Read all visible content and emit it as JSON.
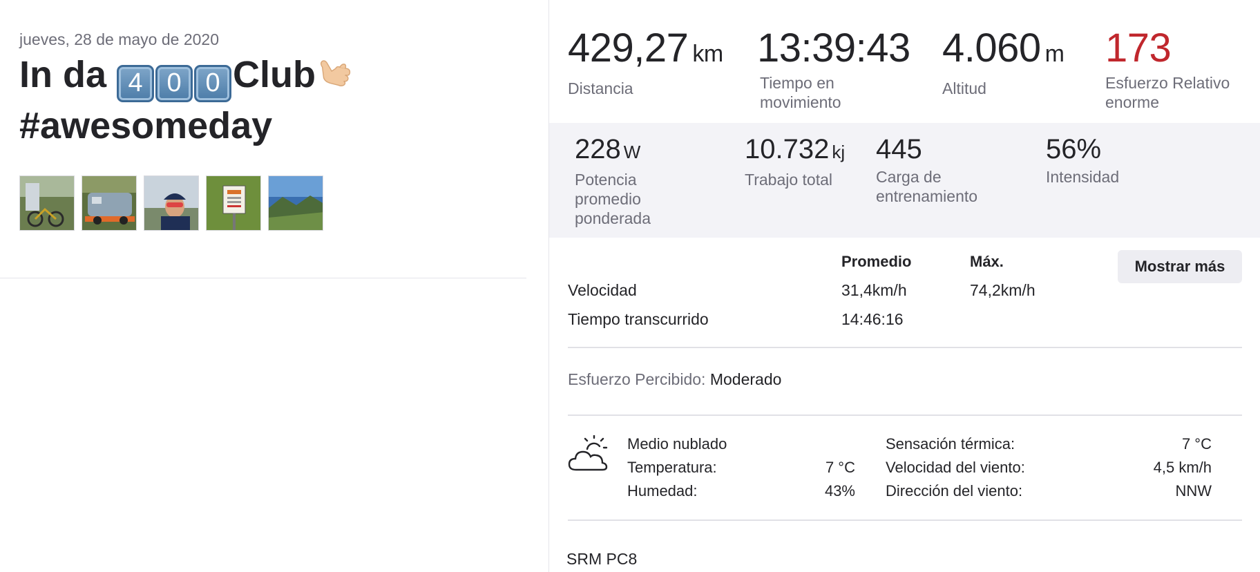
{
  "activity": {
    "date": "jueves, 28 de mayo de 2020",
    "title_prefix": "In da ",
    "title_keycaps": [
      "4",
      "0",
      "0"
    ],
    "title_suffix": "Club",
    "title_line2": "#awesomeday",
    "photos": [
      {
        "name": "photo-bike-shed"
      },
      {
        "name": "photo-blue-van"
      },
      {
        "name": "photo-selfie-cyclist"
      },
      {
        "name": "photo-road-sign"
      },
      {
        "name": "photo-mountain-valley"
      }
    ]
  },
  "summary": {
    "distance": {
      "value": "429,27",
      "unit": "km",
      "label": "Distancia"
    },
    "moving_time": {
      "value": "13:39:43",
      "label_line1": "Tiempo en",
      "label_line2": "movimiento"
    },
    "elevation": {
      "value": "4.060",
      "unit": "m",
      "label": "Altitud"
    },
    "relative_effort": {
      "value": "173",
      "label_line1": "Esfuerzo Relativo",
      "label_line2": "enorme",
      "color": "#c0272d"
    }
  },
  "power": {
    "weighted_avg": {
      "value": "228",
      "unit": "W",
      "label_line1": "Potencia",
      "label_line2": "promedio",
      "label_line3": "ponderada"
    },
    "total_work": {
      "value": "10.732",
      "unit": "kj",
      "label": "Trabajo total"
    },
    "training_load": {
      "value": "445",
      "label_line1": "Carga de",
      "label_line2": "entrenamiento"
    },
    "intensity": {
      "value": "56%",
      "label": "Intensidad"
    }
  },
  "table": {
    "col_avg": "Promedio",
    "col_max": "Máx.",
    "show_more": "Mostrar más",
    "rows": [
      {
        "label": "Velocidad",
        "avg": "31,4km/h",
        "max": "74,2km/h"
      },
      {
        "label": "Tiempo transcurrido",
        "avg": "14:46:16",
        "max": ""
      }
    ]
  },
  "perceived": {
    "label": "Esfuerzo Percibido:",
    "value": "Moderado"
  },
  "weather": {
    "icon": "partly-cloudy-icon",
    "condition": "Medio nublado",
    "temperature_label": "Temperatura:",
    "temperature": "7 °C",
    "humidity_label": "Humedad:",
    "humidity": "43%",
    "feels_like_label": "Sensación térmica:",
    "feels_like": "7 °C",
    "wind_speed_label": "Velocidad del viento:",
    "wind_speed": "4,5 km/h",
    "wind_dir_label": "Dirección del viento:",
    "wind_dir": "NNW"
  },
  "device": "SRM PC8"
}
